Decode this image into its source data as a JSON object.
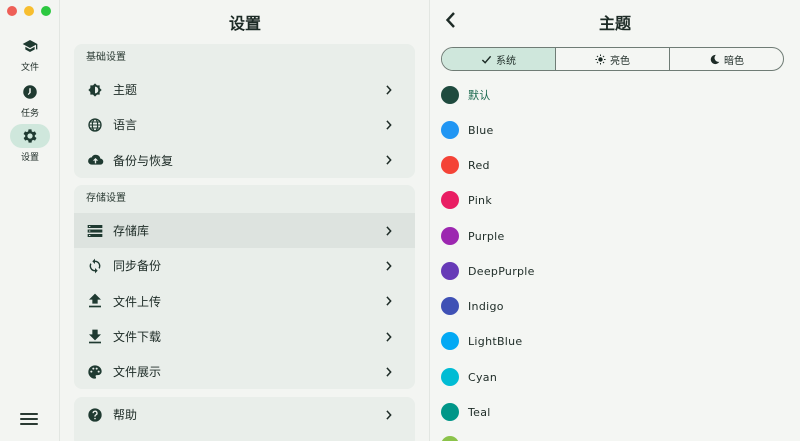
{
  "window": {
    "traffic_colors": [
      "#ee5f57",
      "#f7be2f",
      "#2cc840"
    ]
  },
  "rail": {
    "items": [
      {
        "label": "文件",
        "icon": "school-icon"
      },
      {
        "label": "任务",
        "icon": "progress-icon"
      },
      {
        "label": "设置",
        "icon": "gear-icon",
        "active": true
      }
    ],
    "menu_icon": "hamburger-icon"
  },
  "settings": {
    "title": "设置",
    "groups": [
      {
        "header": "基础设置",
        "items": [
          {
            "label": "主题",
            "icon": "brightness-icon"
          },
          {
            "label": "语言",
            "icon": "globe-icon"
          },
          {
            "label": "备份与恢复",
            "icon": "cloud-upload-icon"
          }
        ]
      },
      {
        "header": "存储设置",
        "items": [
          {
            "label": "存储库",
            "icon": "storage-icon",
            "selected": true
          },
          {
            "label": "同步备份",
            "icon": "sync-icon"
          },
          {
            "label": "文件上传",
            "icon": "upload-icon"
          },
          {
            "label": "文件下载",
            "icon": "download-icon"
          },
          {
            "label": "文件展示",
            "icon": "palette-icon"
          }
        ]
      },
      {
        "header": "",
        "items": [
          {
            "label": "帮助",
            "icon": "help-icon"
          }
        ]
      }
    ]
  },
  "theme": {
    "title": "主题",
    "modes": [
      {
        "label": "系统",
        "icon": "check-icon",
        "selected": true
      },
      {
        "label": "亮色",
        "icon": "sun-icon"
      },
      {
        "label": "暗色",
        "icon": "moon-icon"
      }
    ],
    "colors": [
      {
        "name": "默认",
        "hex": "#1e4a3e",
        "selected": true
      },
      {
        "name": "Blue",
        "hex": "#2196f3"
      },
      {
        "name": "Red",
        "hex": "#f44336"
      },
      {
        "name": "Pink",
        "hex": "#e91e63"
      },
      {
        "name": "Purple",
        "hex": "#9c27b0"
      },
      {
        "name": "DeepPurple",
        "hex": "#673ab7"
      },
      {
        "name": "Indigo",
        "hex": "#3f51b5"
      },
      {
        "name": "LightBlue",
        "hex": "#03a9f4"
      },
      {
        "name": "Cyan",
        "hex": "#00bcd4"
      },
      {
        "name": "Teal",
        "hex": "#009688"
      }
    ]
  }
}
